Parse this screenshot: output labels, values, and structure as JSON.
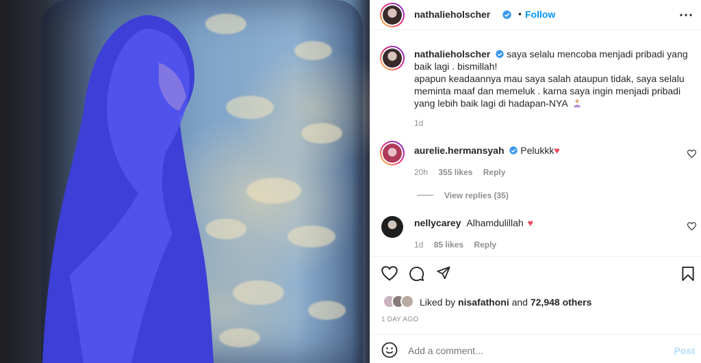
{
  "post": {
    "author": "nathalieholscher",
    "follow_label": "Follow",
    "separator": "•",
    "caption_line1": "saya selalu mencoba menjadi pribadi yang",
    "caption_line2": "baik lagi . bismillah!",
    "caption_line3": "apapun keadaannya mau saya salah ataupun tidak, saya selalu",
    "caption_line4": "meminta maaf dan memeluk . karna saya ingin menjadi pribadi",
    "caption_line5": "yang lebih baik lagi di hadapan-NYA",
    "caption_time": "1d"
  },
  "comments": [
    {
      "username": "aurelie.hermansyah",
      "verified": true,
      "text": "Pelukkk",
      "time": "20h",
      "likes": "355 likes",
      "reply_label": "Reply",
      "view_replies": "View replies (35)"
    },
    {
      "username": "nellycarey",
      "verified": false,
      "text": "Alhamdulillah",
      "time": "1d",
      "likes": "85 likes",
      "reply_label": "Reply"
    }
  ],
  "likes_bar": {
    "prefix": "Liked by",
    "liker": "nisafathoni",
    "and": "and",
    "others": "72,948 others",
    "date": "1 DAY AGO"
  },
  "comment_box": {
    "placeholder": "Add a comment...",
    "post_label": "Post"
  },
  "colors": {
    "accent": "#0095f6",
    "heart": "#ed4956",
    "muted": "#8e8e8e"
  }
}
